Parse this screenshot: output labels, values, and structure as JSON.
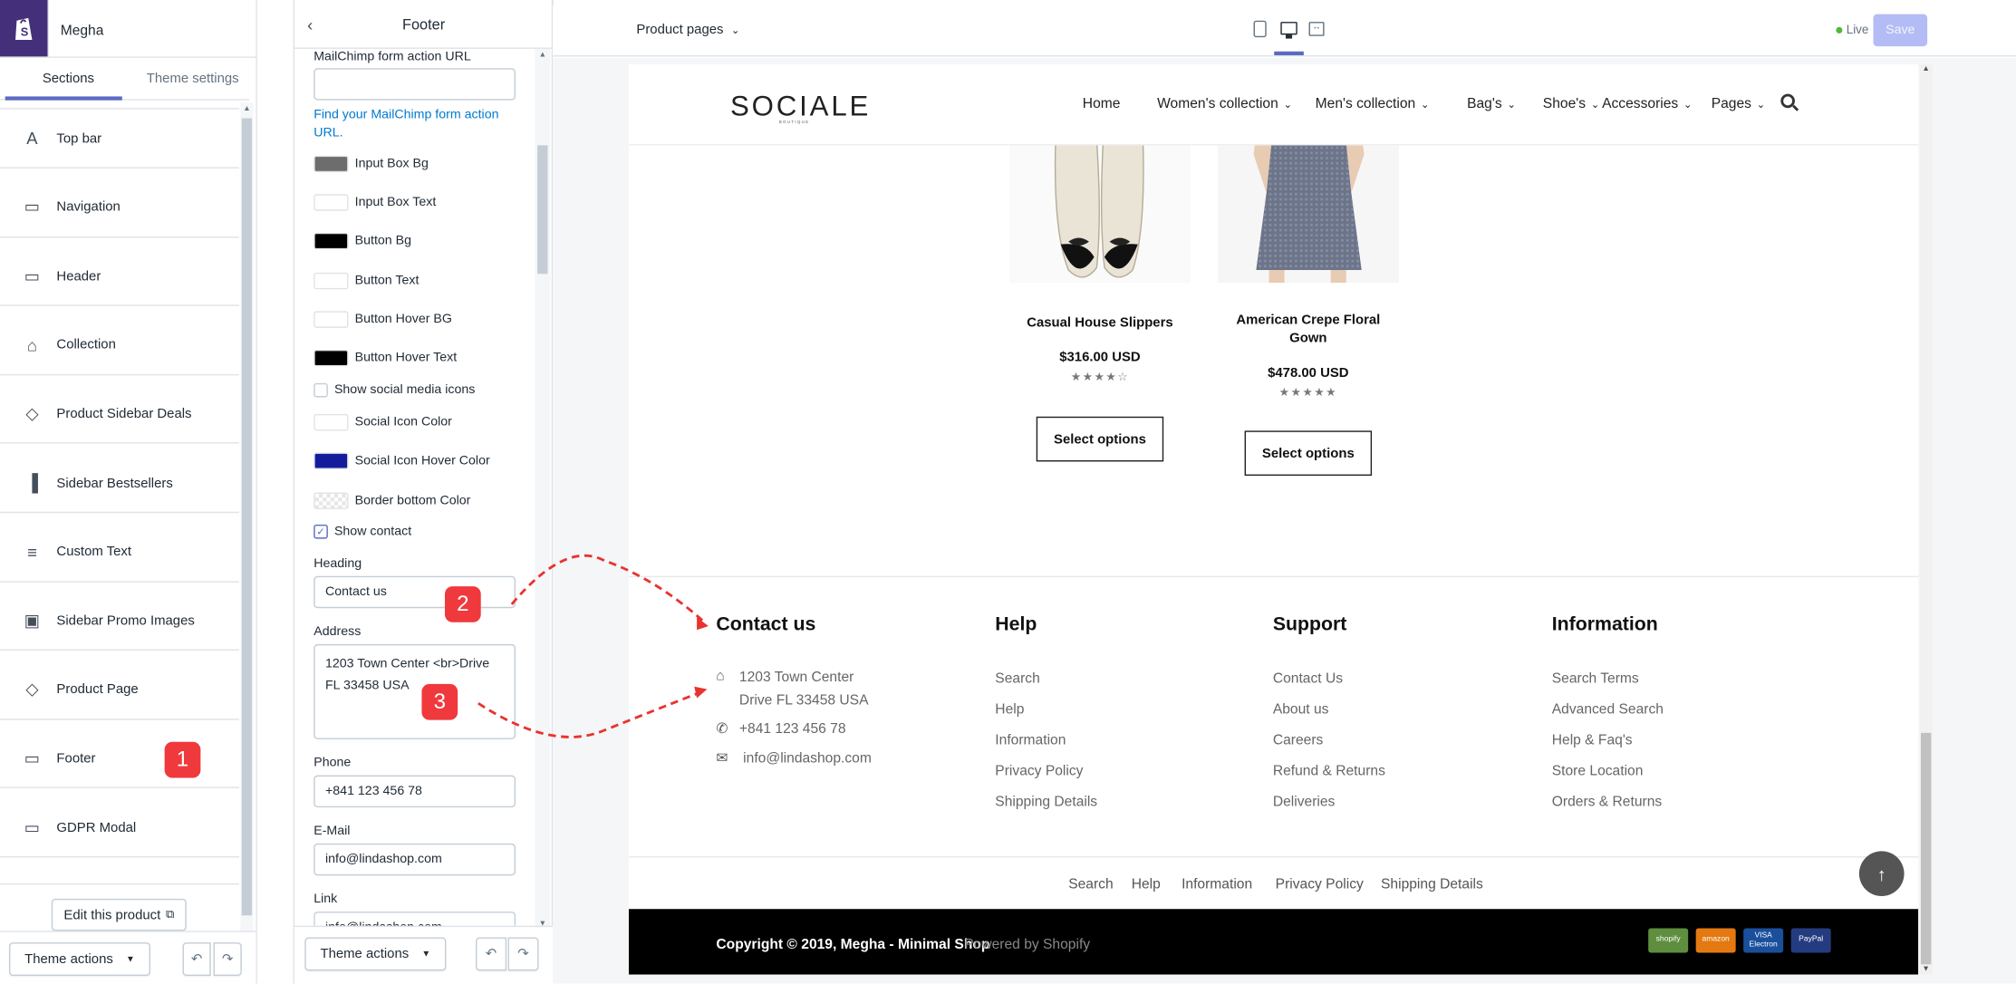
{
  "store": {
    "name": "Megha"
  },
  "left_panel": {
    "tabs": [
      {
        "label": "Sections"
      },
      {
        "label": "Theme settings"
      }
    ],
    "sections": [
      {
        "label": "Top bar",
        "icon": "text-icon"
      },
      {
        "label": "Navigation",
        "icon": "navigation-icon"
      },
      {
        "label": "Header",
        "icon": "header-icon"
      },
      {
        "label": "Collection",
        "icon": "collection-icon"
      },
      {
        "label": "Product Sidebar Deals",
        "icon": "tag-icon"
      },
      {
        "label": "Sidebar Bestsellers",
        "icon": "sidebar-icon"
      },
      {
        "label": "Custom Text",
        "icon": "text-block-icon"
      },
      {
        "label": "Sidebar Promo Images",
        "icon": "image-icon"
      },
      {
        "label": "Product Page",
        "icon": "tag-icon"
      },
      {
        "label": "Footer",
        "icon": "footer-icon"
      },
      {
        "label": "GDPR Modal",
        "icon": "modal-icon"
      }
    ],
    "edit_product_label": "Edit this product",
    "theme_actions_label": "Theme actions"
  },
  "footer_panel": {
    "title": "Footer",
    "mailchimp_label": "MailChimp form action URL",
    "mailchimp_value": "",
    "mailchimp_help": "Find your MailChimp form action URL.",
    "colors": [
      {
        "label": "Input Box Bg",
        "color": "#6d6d6d"
      },
      {
        "label": "Input Box Text",
        "color": "#ffffff"
      },
      {
        "label": "Button Bg",
        "color": "#000000"
      },
      {
        "label": "Button Text",
        "color": "#ffffff"
      },
      {
        "label": "Button Hover BG",
        "color": "#ffffff"
      },
      {
        "label": "Button Hover Text",
        "color": "#000000"
      }
    ],
    "show_social_label": "Show social media icons",
    "show_social_checked": false,
    "social_colors": [
      {
        "label": "Social Icon Color",
        "color": "#ffffff"
      },
      {
        "label": "Social Icon Hover Color",
        "color": "#141c9c"
      },
      {
        "label": "Border bottom Color",
        "color": "transparent"
      }
    ],
    "show_contact_label": "Show contact",
    "show_contact_checked": true,
    "heading_label": "Heading",
    "heading_value": "Contact us",
    "address_label": "Address",
    "address_value": "1203 Town Center <br>Drive FL 33458 USA",
    "phone_label": "Phone",
    "phone_value": "+841 123 456 78",
    "email_label": "E-Mail",
    "email_value": "info@lindashop.com",
    "link_label": "Link",
    "link_value": "info@lindashop.com",
    "theme_actions_label": "Theme actions"
  },
  "annotations": [
    {
      "number": "1"
    },
    {
      "number": "2"
    },
    {
      "number": "3"
    }
  ],
  "topbar": {
    "page_select": "Product pages",
    "live_label": "Live",
    "save_label": "Save"
  },
  "site": {
    "logo": "SOCIALE",
    "logo_sub": "BOUTIQUE",
    "nav": [
      {
        "label": "Home",
        "dropdown": false
      },
      {
        "label": "Women's collection",
        "dropdown": true
      },
      {
        "label": "Men's collection",
        "dropdown": true
      },
      {
        "label": "Bag's",
        "dropdown": true
      },
      {
        "label": "Shoe's",
        "dropdown": true
      },
      {
        "label": "Accessories",
        "dropdown": true
      },
      {
        "label": "Pages",
        "dropdown": true
      }
    ],
    "products": [
      {
        "title": "Casual House Slippers",
        "price": "$316.00 USD",
        "stars": "★★★★☆",
        "button": "Select options"
      },
      {
        "title": "American Crepe Floral Gown",
        "price": "$478.00 USD",
        "stars": "★★★★★",
        "button": "Select options"
      }
    ],
    "footer": {
      "contact": {
        "heading": "Contact us",
        "address_line1": "1203 Town Center",
        "address_line2": "Drive FL 33458 USA",
        "phone": "+841 123 456 78",
        "email": "info@lindashop.com"
      },
      "columns": [
        {
          "heading": "Help",
          "links": [
            "Search",
            "Help",
            "Information",
            "Privacy Policy",
            "Shipping Details"
          ]
        },
        {
          "heading": "Support",
          "links": [
            "Contact Us",
            "About us",
            "Careers",
            "Refund & Returns",
            "Deliveries"
          ]
        },
        {
          "heading": "Information",
          "links": [
            "Search Terms",
            "Advanced Search",
            "Help & Faq's",
            "Store Location",
            "Orders & Returns"
          ]
        }
      ],
      "bottom_links": [
        "Search",
        "Help",
        "Information",
        "Privacy Policy",
        "Shipping Details"
      ],
      "copyright": "Copyright © 2019, Megha - Minimal Shop",
      "powered": "Powered by Shopify",
      "payments": [
        {
          "label": "shopify",
          "color": "#5e8e3e"
        },
        {
          "label": "amazon",
          "color": "#e47911"
        },
        {
          "label": "VISA Electron",
          "color": "#1a4f9c"
        },
        {
          "label": "PayPal",
          "color": "#253b80"
        }
      ]
    }
  }
}
